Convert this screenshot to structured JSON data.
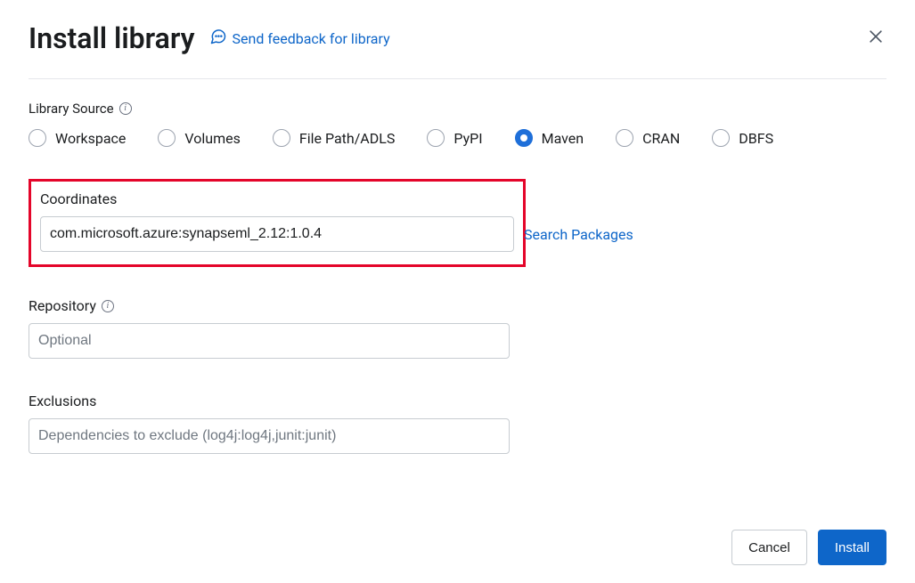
{
  "header": {
    "title": "Install library",
    "feedback_label": "Send feedback for library"
  },
  "library_source": {
    "label": "Library Source",
    "selected": "Maven",
    "options": [
      "Workspace",
      "Volumes",
      "File Path/ADLS",
      "PyPI",
      "Maven",
      "CRAN",
      "DBFS"
    ]
  },
  "coordinates": {
    "label": "Coordinates",
    "value": "com.microsoft.azure:synapseml_2.12:1.0.4",
    "search_label": "Search Packages"
  },
  "repository": {
    "label": "Repository",
    "placeholder": "Optional",
    "value": ""
  },
  "exclusions": {
    "label": "Exclusions",
    "placeholder": "Dependencies to exclude (log4j:log4j,junit:junit)",
    "value": ""
  },
  "footer": {
    "cancel_label": "Cancel",
    "install_label": "Install"
  }
}
